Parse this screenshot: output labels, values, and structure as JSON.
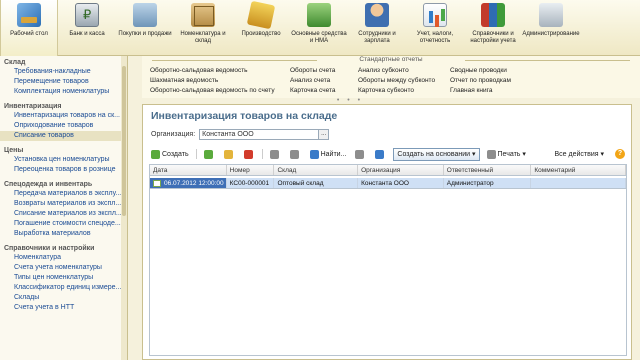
{
  "sections": [
    {
      "name": "sect-desktop",
      "icon": "desktop-icon",
      "label": "Рабочий стол",
      "active": true
    },
    {
      "name": "sect-bank",
      "icon": "bank-icon",
      "label": "Банк и касса"
    },
    {
      "name": "sect-purchases",
      "icon": "cart-icon",
      "label": "Покупки и продажи"
    },
    {
      "name": "sect-warehouse",
      "icon": "box-icon",
      "label": "Номенклатура и склад"
    },
    {
      "name": "sect-production",
      "icon": "tools-icon",
      "label": "Производство"
    },
    {
      "name": "sect-assets",
      "icon": "building-icon",
      "label": "Основные средства и НМА"
    },
    {
      "name": "sect-staff",
      "icon": "people-icon",
      "label": "Сотрудники и зарплата"
    },
    {
      "name": "sect-accounting",
      "icon": "chart-icon",
      "label": "Учет, налоги, отчетность"
    },
    {
      "name": "sect-refs",
      "icon": "books-icon",
      "label": "Справочники и настройки учета"
    },
    {
      "name": "sect-admin",
      "icon": "admin-icon",
      "label": "Администрирование"
    }
  ],
  "nav": {
    "groups": [
      {
        "title": "Склад",
        "items": [
          "Требования-накладные",
          "Перемещение товаров",
          "Комплектация номенклатуры"
        ]
      },
      {
        "title": "Инвентаризация",
        "items": [
          "Инвентаризация товаров на ск...",
          "Оприходование товаров",
          "Списание товаров"
        ]
      },
      {
        "title": "Цены",
        "items": [
          "Установка цен номенклатуры",
          "Переоценка товаров в рознице"
        ]
      },
      {
        "title": "Спецодежда и инвентарь",
        "items": [
          "Передача материалов в эксплу...",
          "Возвраты материалов из экспл...",
          "Списание материалов из экспл...",
          "Погашение стоимости спецоде...",
          "Выработка материалов"
        ]
      },
      {
        "title": "Справочники и настройки",
        "items": [
          "Номенклатура",
          "Счета учета номенклатуры",
          "Типы цен номенклатуры",
          "Классификатор единиц измере...",
          "Склады",
          "Счета учета в НТТ"
        ]
      }
    ]
  },
  "reports": {
    "header": "Стандартные отчеты",
    "col1": [
      "Оборотно-сальдовая ведомость",
      "Шахматная ведомость",
      "Оборотно-сальдовая ведомость по счету"
    ],
    "col2": [
      "Обороты счета",
      "Анализ счета",
      "Карточка счета"
    ],
    "col3": [
      "Анализ субконто",
      "Обороты между субконто",
      "Карточка субконто"
    ],
    "col4": [
      "Сводные проводки",
      "Отчет по проводкам",
      "Главная книга"
    ],
    "dots": "• • •"
  },
  "document": {
    "title": "Инвентаризация товаров на складе",
    "org_label": "Организация:",
    "org_value": "Константа ООО",
    "org_button": "...",
    "toolbar": {
      "create": "Создать",
      "find": "Найти...",
      "create_based": "Создать на основании",
      "print": "Печать",
      "all_actions": "Все действия",
      "help": "?"
    },
    "columns": [
      "Дата",
      "Номер",
      "Склад",
      "Организация",
      "Ответственный",
      "Комментарий"
    ],
    "rows": [
      {
        "date": "06.07.2012 12:00:00",
        "number": "КС00-000001",
        "warehouse": "Оптовый склад",
        "org": "Константа ООО",
        "responsible": "Администратор",
        "comment": ""
      }
    ]
  }
}
